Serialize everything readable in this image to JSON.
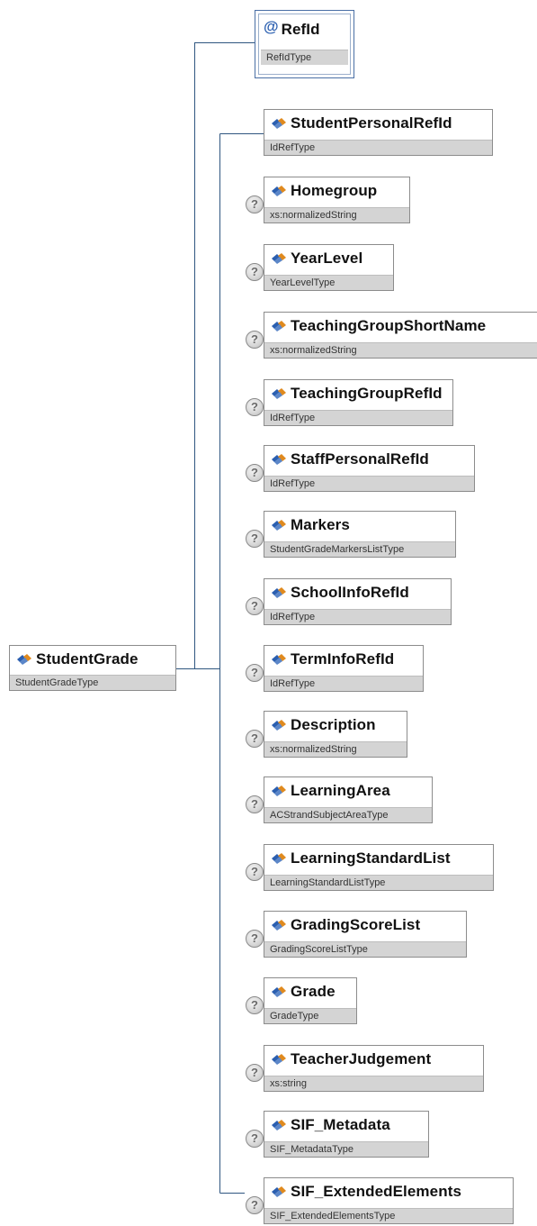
{
  "root": {
    "name": "StudentGrade",
    "type": "StudentGradeType"
  },
  "attribute": {
    "name": "RefId",
    "type": "RefIdType",
    "icon": "at-icon"
  },
  "children": [
    {
      "name": "StudentPersonalRefId",
      "type": "IdRefType",
      "optional": false
    },
    {
      "name": "Homegroup",
      "type": "xs:normalizedString",
      "optional": true
    },
    {
      "name": "YearLevel",
      "type": "YearLevelType",
      "optional": true
    },
    {
      "name": "TeachingGroupShortName",
      "type": "xs:normalizedString",
      "optional": true
    },
    {
      "name": "TeachingGroupRefId",
      "type": "IdRefType",
      "optional": true
    },
    {
      "name": "StaffPersonalRefId",
      "type": "IdRefType",
      "optional": true
    },
    {
      "name": "Markers",
      "type": "StudentGradeMarkersListType",
      "optional": true
    },
    {
      "name": "SchoolInfoRefId",
      "type": "IdRefType",
      "optional": true
    },
    {
      "name": "TermInfoRefId",
      "type": "IdRefType",
      "optional": true
    },
    {
      "name": "Description",
      "type": "xs:normalizedString",
      "optional": true
    },
    {
      "name": "LearningArea",
      "type": "ACStrandSubjectAreaType",
      "optional": true
    },
    {
      "name": "LearningStandardList",
      "type": "LearningStandardListType",
      "optional": true
    },
    {
      "name": "GradingScoreList",
      "type": "GradingScoreListType",
      "optional": true
    },
    {
      "name": "Grade",
      "type": "GradeType",
      "optional": true
    },
    {
      "name": "TeacherJudgement",
      "type": "xs:string",
      "optional": true
    },
    {
      "name": "SIF_Metadata",
      "type": "SIF_MetadataType",
      "optional": true
    },
    {
      "name": "SIF_ExtendedElements",
      "type": "SIF_ExtendedElementsType",
      "optional": true
    }
  ],
  "optional_marker": "?",
  "attribute_marker": "@",
  "colors": {
    "type_bar": "#d4d4d4",
    "connector": "#2f5680",
    "attribute_border": "#4a6fa5",
    "icon_blue": "#2b5fb0",
    "icon_orange": "#e08a1e"
  }
}
